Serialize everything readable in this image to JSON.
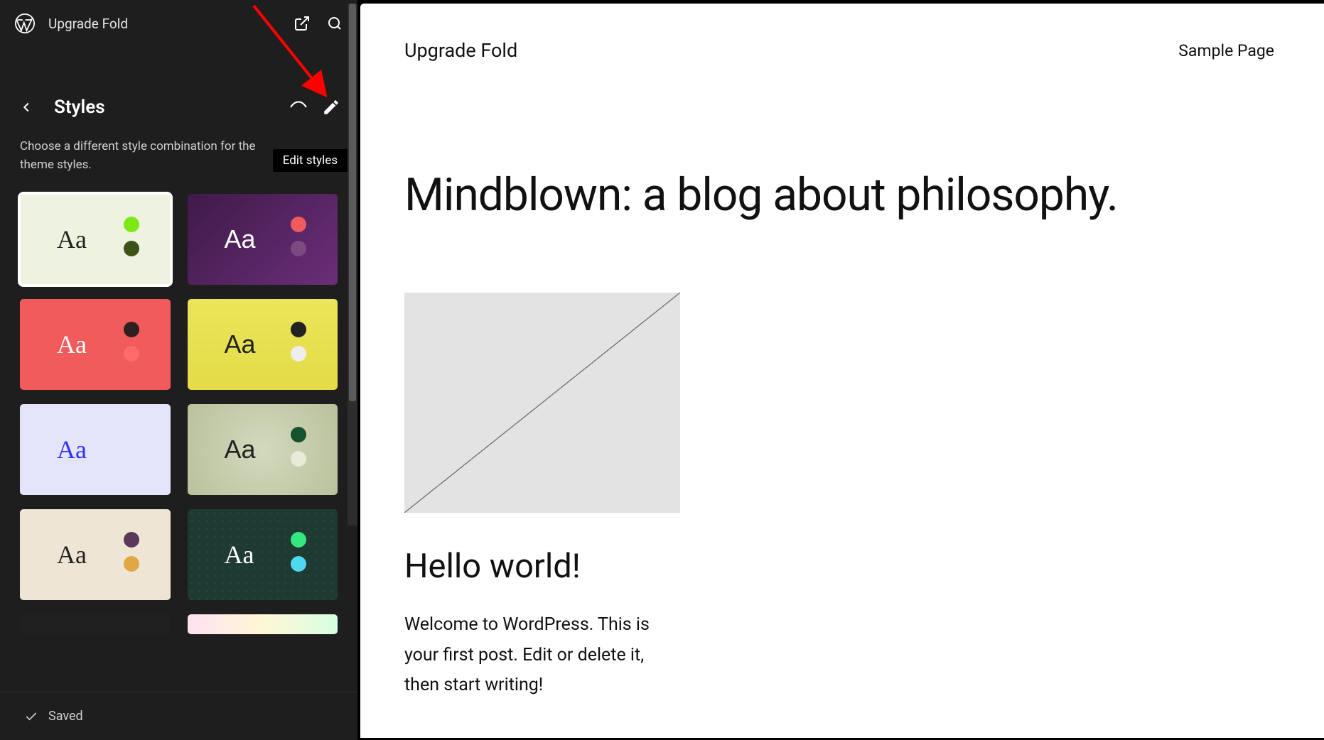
{
  "topbar": {
    "site_title": "Upgrade Fold"
  },
  "styles_panel": {
    "title": "Styles",
    "description": "Choose a different style combination for the theme styles.",
    "tooltip": "Edit styles",
    "tiles": [
      {
        "bg": "#eef2e0",
        "text": "#222",
        "sample": "Aa",
        "c1": "#7ee817",
        "c2": "#3c5218",
        "selected": true
      },
      {
        "bg": "#5c2567",
        "text": "#fff",
        "sample": "Aa",
        "c1": "#f15b5b",
        "c2": "#7e4880",
        "selected": false,
        "grad": "linear-gradient(135deg,#3f1a4a,#6b2e78)"
      },
      {
        "bg": "#f15b5b",
        "text": "#fff",
        "sample": "Aa",
        "c1": "#2e2020",
        "c2": "#ff6a6a",
        "selected": false
      },
      {
        "bg": "#e9e356",
        "text": "#222",
        "sample": "Aa",
        "c1": "#222",
        "c2": "#eee",
        "selected": false,
        "grad": "linear-gradient(180deg,#ebe55a,#e3dc47)"
      },
      {
        "bg": "#e4e5fb",
        "text": "#3030ff",
        "sample": "Aa",
        "c1": "transparent",
        "c2": "transparent",
        "selected": false
      },
      {
        "bg": "#c8cfae",
        "text": "#222",
        "sample": "Aa",
        "c1": "#14532d",
        "c2": "#e9ead8",
        "selected": false,
        "grad": "radial-gradient(circle at 50% 50%, #d3d9bd, #b9c19c)"
      },
      {
        "bg": "#efe5d5",
        "text": "#222",
        "sample": "Aa",
        "c1": "#5a3a5b",
        "c2": "#e0a742",
        "selected": false
      },
      {
        "bg": "#1f3a33",
        "text": "#fff",
        "sample": "Aa",
        "c1": "#34e77f",
        "c2": "#4fd9ee",
        "selected": false,
        "pattern": true
      },
      {
        "bg": "#202020",
        "text": "#fff",
        "sample": "",
        "c1": "transparent",
        "c2": "transparent",
        "selected": false,
        "last": true
      },
      {
        "bg": "linear-gradient(90deg,#ffe1f1,#fff7d6,#d6ffe1)",
        "text": "#222",
        "sample": "",
        "c1": "transparent",
        "c2": "transparent",
        "selected": false,
        "last": true,
        "grad": "linear-gradient(90deg,#ffe1f1,#fff7d6,#d6ffe1)"
      }
    ]
  },
  "footer": {
    "status": "Saved"
  },
  "preview": {
    "site_title": "Upgrade Fold",
    "nav_item": "Sample Page",
    "hero": "Mindblown: a blog about philosophy.",
    "post_title": "Hello world!",
    "post_body": "Welcome to WordPress. This is your first post. Edit or delete it, then start writing!"
  }
}
